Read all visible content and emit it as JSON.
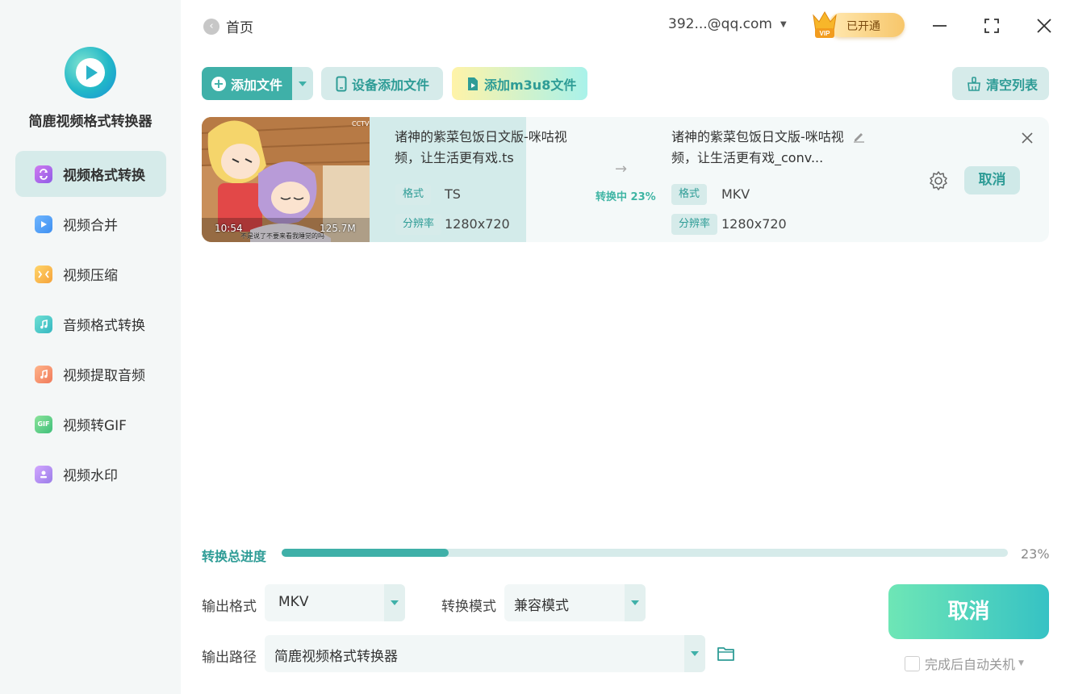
{
  "app": {
    "name": "简鹿视频格式转换器"
  },
  "sidebar": {
    "items": [
      {
        "label": "视频格式转换",
        "icon": "convert-icon",
        "color": "#b06ae8",
        "active": true
      },
      {
        "label": "视频合并",
        "icon": "merge-icon",
        "color": "#3e8ff0",
        "active": false
      },
      {
        "label": "视频压缩",
        "icon": "compress-icon",
        "color": "#f5b23a",
        "active": false
      },
      {
        "label": "音频格式转换",
        "icon": "music-icon",
        "color": "#35c1b4",
        "active": false
      },
      {
        "label": "视频提取音频",
        "icon": "extract-audio-icon",
        "color": "#f08a5a",
        "active": false
      },
      {
        "label": "视频转GIF",
        "icon": "gif-icon",
        "color": "#4cc27a",
        "active": false
      },
      {
        "label": "视频水印",
        "icon": "watermark-icon",
        "color": "#a97de8",
        "active": false
      }
    ]
  },
  "topbar": {
    "home_label": "首页",
    "account": "392...@qq.com",
    "vip_status": "已开通",
    "vip_badge": "VIP"
  },
  "toolbar": {
    "add_file": "添加文件",
    "device_add": "设备添加文件",
    "add_m3u8": "添加m3u8文件",
    "clear_list": "清空列表"
  },
  "file": {
    "thumb_duration": "10:54",
    "thumb_size": "125.7M",
    "thumb_subtitle": "不是说了不要来看我睡觉的吗",
    "thumb_channel": "CCTV",
    "source_name": "诸神的紫菜包饭日文版-咪咕视频，让生活更有戏.ts",
    "target_name": "诸神的紫菜包饭日文版-咪咕视频，让生活更有戏_conv...",
    "format_tag": "格式",
    "resolution_tag": "分辨率",
    "source_format": "TS",
    "source_resolution": "1280x720",
    "target_format": "MKV",
    "target_resolution": "1280x720",
    "status": "转换中 23%",
    "progress": 0.23,
    "cancel_label": "取消"
  },
  "bottom": {
    "total_label": "转换总进度",
    "total_percent": "23%",
    "total_progress": 0.23,
    "output_format_label": "输出格式",
    "output_format_value": "MKV",
    "mode_label": "转换模式",
    "mode_value": "兼容模式",
    "path_label": "输出路径",
    "path_value": "简鹿视频格式转换器",
    "cancel_label": "取消",
    "shutdown_label": "完成后自动关机"
  },
  "colors": {
    "accent": "#3fb0a8",
    "accent_light": "#d6ebea",
    "sidebar_bg": "#f4f7f7"
  }
}
